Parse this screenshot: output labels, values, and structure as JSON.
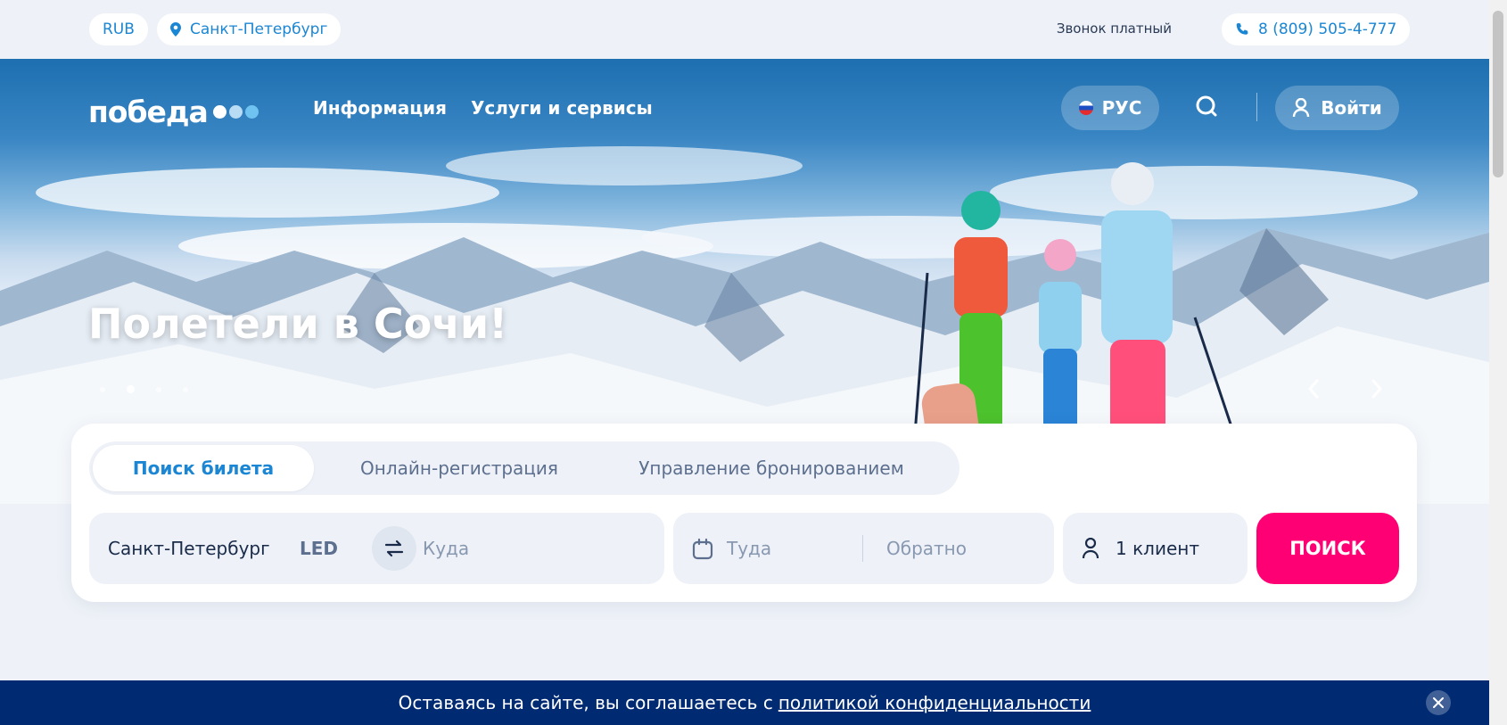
{
  "topbar": {
    "currency": "RUB",
    "city": "Санкт-Петербург",
    "call_note": "Звонок платный",
    "phone": "8 (809) 505-4-777"
  },
  "header": {
    "logo_text": "победа",
    "logo_dot_colors": [
      "#ffffff",
      "#b9dcf5",
      "#6fc3f0"
    ],
    "nav": [
      "Информация",
      "Услуги и сервисы"
    ],
    "language": "РУС",
    "login": "Войти"
  },
  "hero": {
    "headline": "Полетели в Сочи!",
    "slides_total": 4,
    "active_slide": 2
  },
  "booking": {
    "tabs": [
      "Поиск билета",
      "Онлайн-регистрация",
      "Управление бронированием"
    ],
    "active_tab": 0,
    "origin": "Санкт-Петербург",
    "origin_code": "LED",
    "destination_placeholder": "Куда",
    "depart_placeholder": "Туда",
    "return_placeholder": "Обратно",
    "passengers": "1 клиент",
    "search_button": "ПОИСК"
  },
  "cookie": {
    "text": "Оставаясь на сайте, вы соглашаетесь с",
    "link": "политикой конфиденциальности"
  },
  "colors": {
    "accent_blue": "#1b86d3",
    "brand_pink": "#ff0074",
    "banner_navy": "#002b73",
    "page_bg": "#eef2f8"
  }
}
